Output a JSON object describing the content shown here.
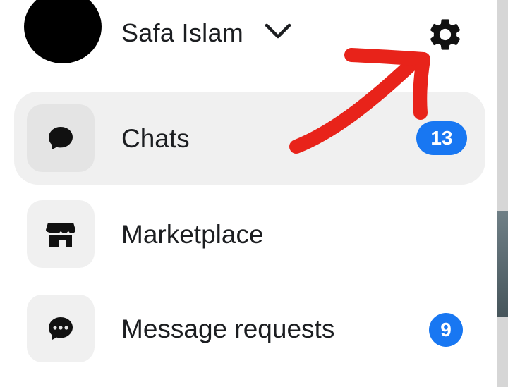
{
  "profile": {
    "name": "Safa Islam"
  },
  "icons": {
    "switch_account": "chevron-down-icon",
    "settings": "gear-icon",
    "chats": "chat-bubble-icon",
    "marketplace": "storefront-icon",
    "message_requests": "chat-dots-icon"
  },
  "menu": {
    "items": [
      {
        "label": "Chats",
        "badge": "13",
        "active": true
      },
      {
        "label": "Marketplace",
        "badge": "",
        "active": false
      },
      {
        "label": "Message requests",
        "badge": "9",
        "active": false
      }
    ]
  },
  "colors": {
    "badge": "#1877f2",
    "annotation_arrow": "#e8231a",
    "active_item_bg": "#f0f0f0"
  }
}
